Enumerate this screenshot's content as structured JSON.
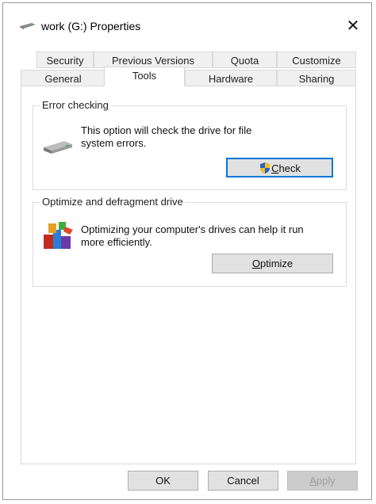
{
  "window": {
    "title": "work (G:) Properties",
    "close_symbol": "✕"
  },
  "tabs": {
    "row1": [
      "Security",
      "Previous Versions",
      "Quota",
      "Customize"
    ],
    "row2": [
      "General",
      "Tools",
      "Hardware",
      "Sharing"
    ],
    "active": "Tools"
  },
  "error_checking": {
    "group_label": "Error checking",
    "description": "This option will check the drive for file system errors.",
    "button_label_rest": "heck",
    "button_mnemonic": "C",
    "icon": "drive-icon",
    "button_icon": "uac-shield-icon"
  },
  "optimize": {
    "group_label": "Optimize and defragment drive",
    "description": "Optimizing your computer's drives can help it run more efficiently.",
    "button_mnemonic": "O",
    "button_label_rest": "ptimize",
    "icon": "defrag-icon"
  },
  "footer": {
    "ok_label": "OK",
    "cancel_label": "Cancel",
    "apply_mnemonic": "A",
    "apply_label_rest": "pply"
  },
  "colors": {
    "accent": "#0078d7",
    "background": "#ffffff",
    "button_face": "#e1e1e1"
  }
}
